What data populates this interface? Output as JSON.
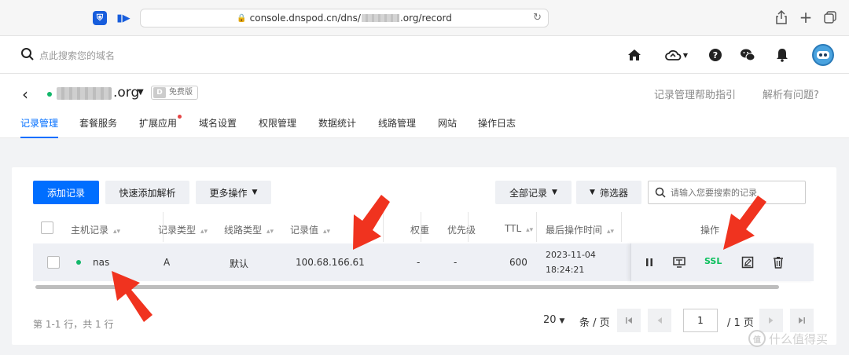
{
  "browser": {
    "url_prefix": "console.dnspod.cn/dns/",
    "url_suffix": ".org/record",
    "icons": [
      "bitwarden-icon",
      "media-play-icon",
      "lock-icon",
      "reload-icon",
      "share-icon",
      "new-tab-icon",
      "tabs-overview-icon"
    ]
  },
  "header": {
    "search_placeholder": "点此搜索您的域名",
    "icons": [
      "home-icon",
      "cloud-icon",
      "help-icon",
      "wechat-icon",
      "bell-icon",
      "avatar"
    ]
  },
  "domain": {
    "tld": ".org",
    "plan_badge": "免费版",
    "help_guide": "记录管理帮助指引",
    "resolve_issue": "解析有问题?"
  },
  "tabs": [
    {
      "label": "记录管理",
      "active": true
    },
    {
      "label": "套餐服务"
    },
    {
      "label": "扩展应用",
      "dot": true
    },
    {
      "label": "域名设置"
    },
    {
      "label": "权限管理"
    },
    {
      "label": "数据统计"
    },
    {
      "label": "线路管理"
    },
    {
      "label": "网站"
    },
    {
      "label": "操作日志"
    }
  ],
  "toolbar": {
    "add_record": "添加记录",
    "quick_add": "快速添加解析",
    "more_ops": "更多操作",
    "all_records": "全部记录",
    "filter": "筛选器",
    "search_placeholder": "请输入您要搜索的记录"
  },
  "table": {
    "columns": [
      "主机记录",
      "记录类型",
      "线路类型",
      "记录值",
      "权重",
      "优先级",
      "TTL",
      "最后操作时间",
      "操作"
    ],
    "rows": [
      {
        "host": "nas",
        "type": "A",
        "line": "默认",
        "value": "100.68.166.61",
        "weight": "-",
        "priority": "-",
        "ttl": "600",
        "date": "2023-11-04",
        "time": "18:24:21",
        "ssl_label": "SSL"
      }
    ]
  },
  "footer": {
    "total": "第 1-1 行，共 1 行",
    "page_size": "20",
    "page_unit": "条 / 页",
    "current_page": "1",
    "total_pages": "/ 1 页"
  },
  "watermark": {
    "logo": "值",
    "text": "什么值得买"
  },
  "colors": {
    "primary": "#006eff",
    "status_green": "#12b76a",
    "ssl_green": "#0abf5b",
    "arrow_red": "#f0331f"
  }
}
